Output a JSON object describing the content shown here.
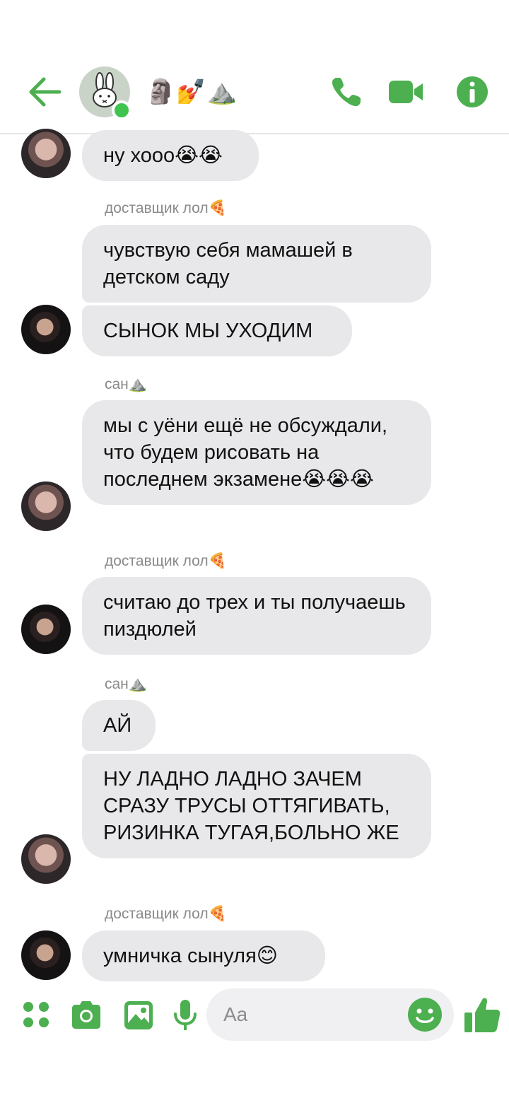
{
  "header": {
    "title": "🗿💅⛰️",
    "accent_color": "#4caf50",
    "online_color": "#3fc44f"
  },
  "messages": [
    {
      "type": "bubble",
      "text": "ну хооо😭😭"
    },
    {
      "type": "sender",
      "text": "доставщик лол🍕"
    },
    {
      "type": "bubble",
      "text": "чувствую себя мамашей в детском саду"
    },
    {
      "type": "bubble",
      "text": "СЫНОК МЫ УХОДИМ"
    },
    {
      "type": "sender",
      "text": "сан⛰️"
    },
    {
      "type": "bubble",
      "text": "мы с уёни ещё не обсуждали, что будем рисовать на последнем экзамене😭😭😭"
    },
    {
      "type": "sender",
      "text": "доставщик лол🍕"
    },
    {
      "type": "bubble",
      "text": "считаю до трех и ты получаешь пиздюлей"
    },
    {
      "type": "sender",
      "text": "сан⛰️"
    },
    {
      "type": "bubble",
      "text": "АЙ"
    },
    {
      "type": "bubble",
      "text": "НУ ЛАДНО ЛАДНО ЗАЧЕМ СРАЗУ ТРУСЫ ОТТЯГИВАТЬ, РИЗИНКА ТУГАЯ,БОЛЬНО ЖЕ"
    },
    {
      "type": "sender",
      "text": "доставщик лол🍕"
    },
    {
      "type": "bubble",
      "text": "умничка сынуля😊"
    }
  ],
  "composer": {
    "placeholder": "Aa"
  }
}
